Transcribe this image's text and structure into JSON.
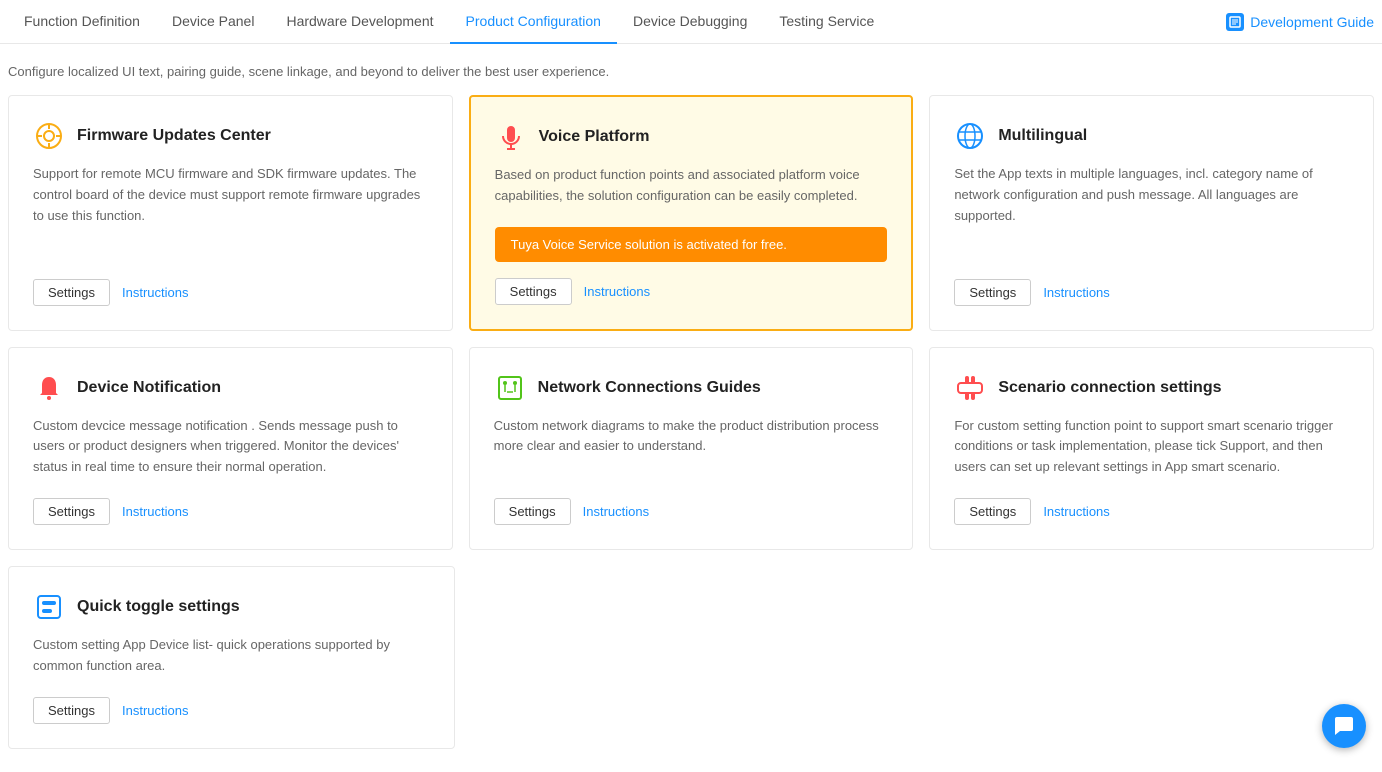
{
  "nav": {
    "items": [
      {
        "label": "Function Definition",
        "active": false
      },
      {
        "label": "Device Panel",
        "active": false
      },
      {
        "label": "Hardware Development",
        "active": false
      },
      {
        "label": "Product Configuration",
        "active": true
      },
      {
        "label": "Device Debugging",
        "active": false
      },
      {
        "label": "Testing Service",
        "active": false
      }
    ],
    "dev_guide_label": "Development Guide"
  },
  "subtitle": "Configure localized UI text, pairing guide, scene linkage, and beyond to deliver the best user experience.",
  "cards": [
    {
      "id": "firmware",
      "icon": "⊕",
      "icon_color": "#faad14",
      "title": "Firmware Updates Center",
      "desc": "Support for remote MCU firmware and SDK firmware updates. The control board of the device must support remote firmware upgrades to use this function.",
      "settings_label": "Settings",
      "instructions_label": "Instructions",
      "highlighted": false,
      "toast": null
    },
    {
      "id": "voice",
      "icon": "🎤",
      "icon_color": "#ff4d4f",
      "title": "Voice Platform",
      "desc": "Based on product function points and associated platform voice capabilities, the solution configuration can be easily completed.",
      "settings_label": "Settings",
      "instructions_label": "Instructions",
      "highlighted": true,
      "toast": "Tuya Voice Service solution is activated for free."
    },
    {
      "id": "multilingual",
      "icon": "🌐",
      "icon_color": "#1890ff",
      "title": "Multilingual",
      "desc": "Set the App texts in multiple languages, incl. category name of network configuration and push message. All languages are supported.",
      "settings_label": "Settings",
      "instructions_label": "Instructions",
      "highlighted": false,
      "toast": null
    },
    {
      "id": "notification",
      "icon": "🔔",
      "icon_color": "#ff4d4f",
      "title": "Device Notification",
      "desc": "Custom devcice message notification . Sends message push to users or product designers when triggered. Monitor the devices' status in real time to ensure their normal operation.",
      "settings_label": "Settings",
      "instructions_label": "Instructions",
      "highlighted": false,
      "toast": null
    },
    {
      "id": "network",
      "icon": "📋",
      "icon_color": "#52c41a",
      "title": "Network Connections Guides",
      "desc": "Custom network diagrams to make the product distribution process more clear and easier to understand.",
      "settings_label": "Settings",
      "instructions_label": "Instructions",
      "highlighted": false,
      "toast": null
    },
    {
      "id": "scenario",
      "icon": "🕹",
      "icon_color": "#ff4d4f",
      "title": "Scenario connection settings",
      "desc": "For custom setting function point to support smart scenario trigger conditions or task implementation, please tick Support, and then users can set up relevant settings in App smart scenario.",
      "settings_label": "Settings",
      "instructions_label": "Instructions",
      "highlighted": false,
      "toast": null
    }
  ],
  "bottom_card": {
    "id": "quick-toggle",
    "icon": "📱",
    "icon_color": "#1890ff",
    "title": "Quick toggle settings",
    "desc": "Custom setting App Device list- quick operations supported by common function area.",
    "settings_label": "Settings",
    "instructions_label": "Instructions"
  }
}
